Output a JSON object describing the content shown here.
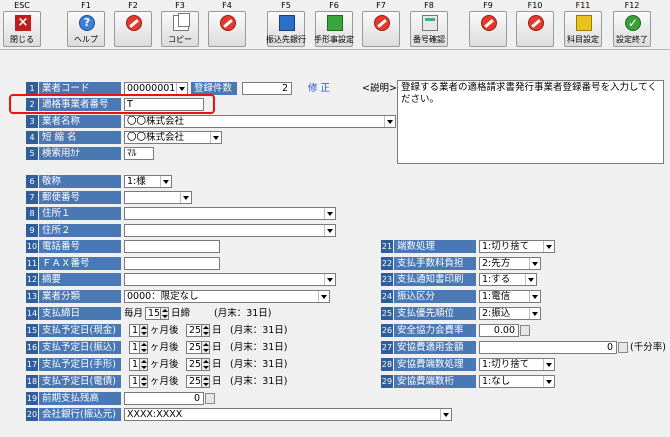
{
  "toolbar": [
    {
      "key": "ESC",
      "label": "閉じる",
      "icon": "close-icon"
    },
    {
      "key": "F1",
      "label": "ヘルプ",
      "icon": "help-icon"
    },
    {
      "key": "F2",
      "label": "",
      "icon": "disabled-icon"
    },
    {
      "key": "F3",
      "label": "コピー",
      "icon": "copy-icon"
    },
    {
      "key": "F4",
      "label": "",
      "icon": "disabled-icon"
    },
    {
      "key": "F5",
      "label": "振込先銀行",
      "icon": "book-icon"
    },
    {
      "key": "F6",
      "label": "手形事設定",
      "icon": "green-book-icon"
    },
    {
      "key": "F7",
      "label": "",
      "icon": "disabled-icon"
    },
    {
      "key": "F8",
      "label": "番号確認",
      "icon": "calculator-icon"
    },
    {
      "key": "F9",
      "label": "",
      "icon": "disabled-icon"
    },
    {
      "key": "F10",
      "label": "",
      "icon": "disabled-icon"
    },
    {
      "key": "F11",
      "label": "科目設定",
      "icon": "yellow-book-icon"
    },
    {
      "key": "F12",
      "label": "設定終了",
      "icon": "check-icon"
    }
  ],
  "form": {
    "f1": {
      "num": "1",
      "label": "業者コード",
      "value": "00000001",
      "count_label": "登録件数",
      "count": "2",
      "mode": "修 正"
    },
    "f2": {
      "num": "2",
      "label": "適格事業者番号",
      "value": "T"
    },
    "f3": {
      "num": "3",
      "label": "業者名称",
      "value": "〇〇株式会社"
    },
    "f4": {
      "num": "4",
      "label": "短 縮 名",
      "value": "〇〇株式会社"
    },
    "f5": {
      "num": "5",
      "label": "検索用ｶﾅ",
      "value": "ﾏﾙ"
    },
    "f6": {
      "num": "6",
      "label": "敬称",
      "value": "1:様"
    },
    "f7": {
      "num": "7",
      "label": "郵便番号",
      "value": ""
    },
    "f8": {
      "num": "8",
      "label": "住所１",
      "value": ""
    },
    "f9": {
      "num": "9",
      "label": "住所２",
      "value": ""
    },
    "f10": {
      "num": "10",
      "label": "電話番号",
      "value": ""
    },
    "f11": {
      "num": "11",
      "label": "ＦＡＸ番号",
      "value": ""
    },
    "f12": {
      "num": "12",
      "label": "摘要",
      "value": ""
    },
    "f13": {
      "num": "13",
      "label": "業者分類",
      "value": "0000：限定なし"
    },
    "f14": {
      "num": "14",
      "label": "支払締日",
      "prefix": "毎月",
      "day": "15",
      "suffix": "日締",
      "note": "(月末：31日)"
    },
    "f15": {
      "num": "15",
      "label": "支払予定日(現金)",
      "months": "1",
      "mid": "ヶ月後",
      "day": "25",
      "suffix": "日",
      "note": "(月末：31日)"
    },
    "f16": {
      "num": "16",
      "label": "支払予定日(振込)",
      "months": "1",
      "mid": "ヶ月後",
      "day": "25",
      "suffix": "日",
      "note": "(月末：31日)"
    },
    "f17": {
      "num": "17",
      "label": "支払予定日(手形)",
      "months": "1",
      "mid": "ヶ月後",
      "day": "25",
      "suffix": "日",
      "note": "(月末：31日)"
    },
    "f18": {
      "num": "18",
      "label": "支払予定日(電債)",
      "months": "1",
      "mid": "ヶ月後",
      "day": "25",
      "suffix": "日",
      "note": "(月末：31日)"
    },
    "f19": {
      "num": "19",
      "label": "前期支払残高",
      "value": "0"
    },
    "f20": {
      "num": "20",
      "label": "会社銀行(振込元)",
      "value": "XXXX:XXXX"
    },
    "f21": {
      "num": "21",
      "label": "端数処理",
      "value": "1:切り捨て"
    },
    "f22": {
      "num": "22",
      "label": "支払手数料負担",
      "value": "2:先方"
    },
    "f23": {
      "num": "23",
      "label": "支払通知書印刷",
      "value": "1:する"
    },
    "f24": {
      "num": "24",
      "label": "振込区分",
      "value": "1:電信"
    },
    "f25": {
      "num": "25",
      "label": "支払優先順位",
      "value": "2:振込"
    },
    "f26": {
      "num": "26",
      "label": "安全協力会費率",
      "value": "0.00"
    },
    "f27": {
      "num": "27",
      "label": "安協費適用金額",
      "value": "0",
      "unit": "(千分率)"
    },
    "f28": {
      "num": "28",
      "label": "安協費端数処理",
      "value": "1:切り捨て"
    },
    "f29": {
      "num": "29",
      "label": "安協費端数桁",
      "value": "1:なし"
    }
  },
  "description": {
    "label": "<説明>",
    "text": "登録する業者の適格請求書発行事業者登録番号を入力してください。"
  },
  "colors": {
    "num_bg": "#2f5e9c",
    "label_bg": "#4a78b5",
    "mode_text": "#1f59c4",
    "highlight": "#ee1111"
  }
}
